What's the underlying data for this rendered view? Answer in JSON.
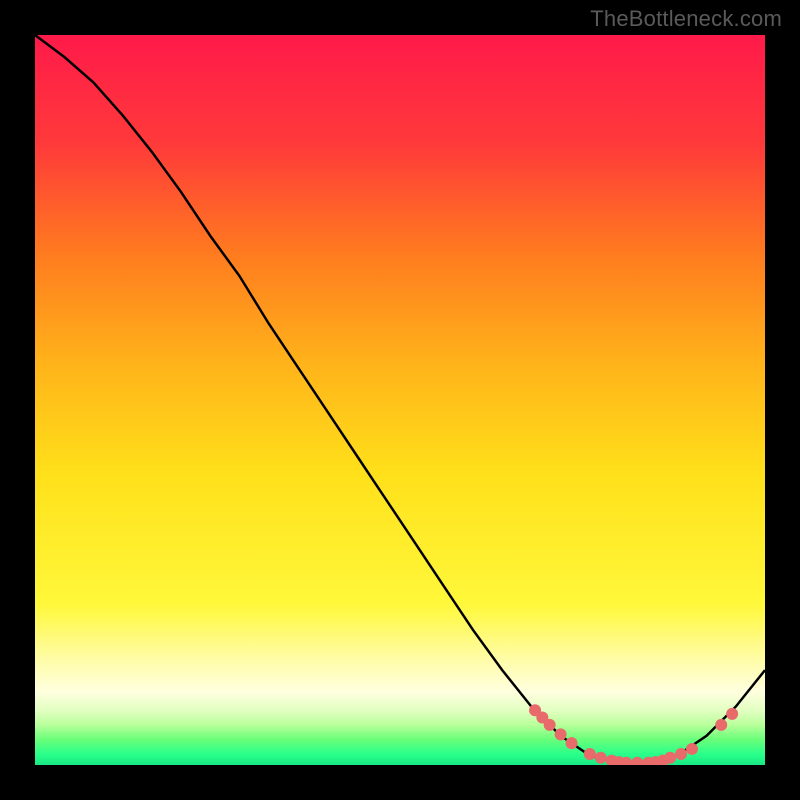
{
  "watermark": "TheBottleneck.com",
  "chart_data": {
    "type": "line",
    "title": "",
    "xlabel": "",
    "ylabel": "",
    "xlim": [
      0,
      100
    ],
    "ylim": [
      0,
      100
    ],
    "series": [
      {
        "name": "curve",
        "x": [
          0,
          4,
          8,
          12,
          16,
          20,
          24,
          28,
          32,
          36,
          40,
          44,
          48,
          52,
          56,
          60,
          64,
          68,
          72,
          76,
          80,
          84,
          88,
          92,
          96,
          100
        ],
        "y": [
          100,
          97,
          93.5,
          89,
          84,
          78.5,
          72.5,
          67,
          60.5,
          54.5,
          48.5,
          42.5,
          36.5,
          30.5,
          24.5,
          18.5,
          13,
          8,
          4,
          1.3,
          0.3,
          0.3,
          1.3,
          4,
          8,
          13
        ]
      }
    ],
    "markers": {
      "name": "points",
      "x": [
        68.5,
        69.5,
        70.5,
        72,
        73.5,
        76,
        77.5,
        79,
        80,
        81,
        82.5,
        84,
        85,
        86,
        87,
        88.5,
        90,
        94,
        95.5
      ],
      "y": [
        7.5,
        6.5,
        5.5,
        4.2,
        3,
        1.5,
        1,
        0.6,
        0.4,
        0.3,
        0.3,
        0.3,
        0.4,
        0.6,
        1,
        1.5,
        2.2,
        5.5,
        7
      ]
    },
    "gradient_bands": [
      {
        "stop": 0.0,
        "color": "#ff1a4a"
      },
      {
        "stop": 0.15,
        "color": "#ff3a3a"
      },
      {
        "stop": 0.3,
        "color": "#ff7b1f"
      },
      {
        "stop": 0.45,
        "color": "#ffb31a"
      },
      {
        "stop": 0.6,
        "color": "#ffe01a"
      },
      {
        "stop": 0.78,
        "color": "#fff83a"
      },
      {
        "stop": 0.85,
        "color": "#fffca0"
      },
      {
        "stop": 0.9,
        "color": "#ffffdf"
      },
      {
        "stop": 0.925,
        "color": "#e2ffc2"
      },
      {
        "stop": 0.945,
        "color": "#b8ff9a"
      },
      {
        "stop": 0.965,
        "color": "#6aff7a"
      },
      {
        "stop": 0.985,
        "color": "#2aff8a"
      },
      {
        "stop": 1.0,
        "color": "#18e884"
      }
    ]
  }
}
